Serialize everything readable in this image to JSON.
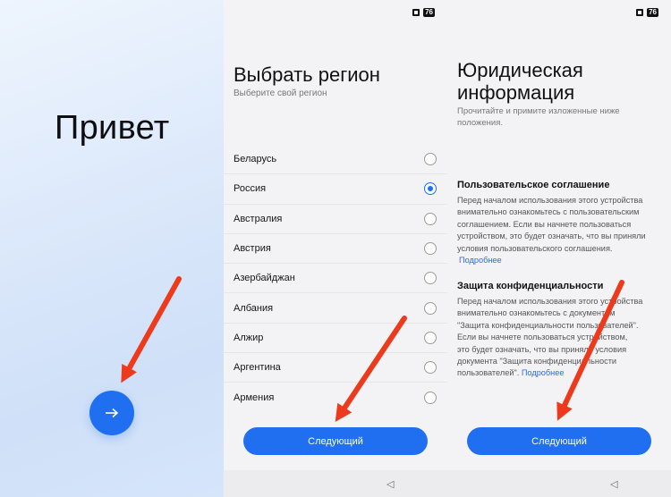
{
  "welcome": {
    "title": "Привет",
    "next_icon": "arrow-right-icon"
  },
  "status_bar": {
    "battery": "76"
  },
  "region": {
    "title": "Выбрать регион",
    "subtitle": "Выберите свой регион",
    "items": [
      {
        "label": "Беларусь",
        "selected": false
      },
      {
        "label": "Россия",
        "selected": true
      },
      {
        "label": "Австралия",
        "selected": false
      },
      {
        "label": "Австрия",
        "selected": false
      },
      {
        "label": "Азербайджан",
        "selected": false
      },
      {
        "label": "Албания",
        "selected": false
      },
      {
        "label": "Алжир",
        "selected": false
      },
      {
        "label": "Аргентина",
        "selected": false
      },
      {
        "label": "Армения",
        "selected": false
      }
    ],
    "next_label": "Следующий"
  },
  "legal": {
    "title_line1": "Юридическая",
    "title_line2": "информация",
    "subtitle_line1": "Прочитайте и примите изложенные ниже",
    "subtitle_line2": "положения.",
    "agreement_title": "Пользовательское соглашение",
    "agreement_text_lines": [
      "Перед началом использования этого устройства",
      "внимательно ознакомьтесь с пользовательским",
      "соглашением. Если вы начнете пользоваться",
      "устройством, это будет означать, что вы приняли",
      "условия пользовательского соглашения."
    ],
    "agreement_more": "Подробнее",
    "privacy_title": "Защита конфиденциальности",
    "privacy_text_lines": [
      "Перед началом использования этого устройства",
      "внимательно ознакомьтесь с документом",
      "\"Защита конфиденциальности пользователей\".",
      "Если вы начнете пользоваться устройством,",
      "это будет означать, что вы приняли условия",
      "документа \"Защита конфиденциальности",
      "пользователей\"."
    ],
    "privacy_more": "Подробнее",
    "next_label": "Следующий"
  },
  "colors": {
    "accent": "#1f6ff0",
    "annotation_arrow": "#ee3a1c"
  }
}
